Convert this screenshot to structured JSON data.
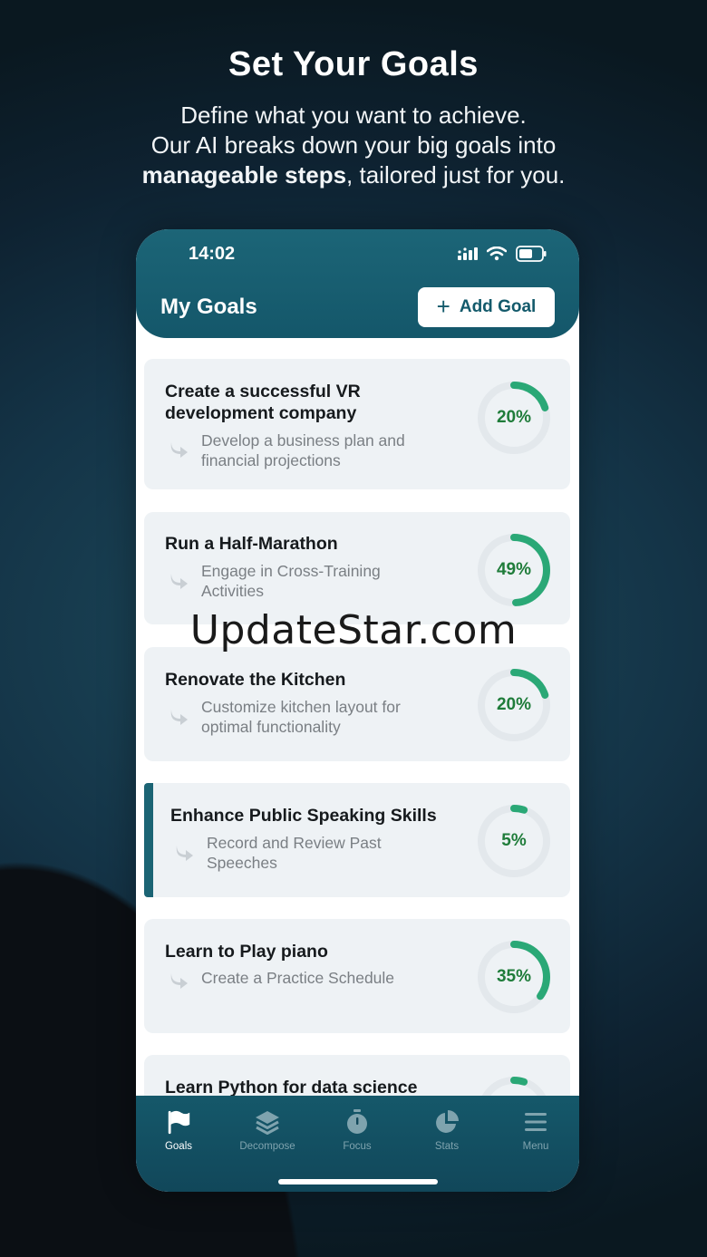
{
  "hero": {
    "title": "Set Your Goals",
    "line1": "Define what you want to achieve.",
    "line2": "Our AI breaks down your big goals  into",
    "line3_bold": "manageable steps",
    "line3_rest": ", tailored just for you."
  },
  "status": {
    "time": "14:02"
  },
  "header": {
    "title": "My Goals",
    "add_label": "Add Goal"
  },
  "goals": [
    {
      "title": "Create a successful VR development company",
      "step": "Develop a business plan and financial projections",
      "percent": 20,
      "percent_label": "20%"
    },
    {
      "title": "Run a Half-Marathon",
      "step": "Engage in Cross-Training Activities",
      "percent": 49,
      "percent_label": "49%"
    },
    {
      "title": "Renovate the Kitchen",
      "step": "Customize kitchen layout for optimal functionality",
      "percent": 20,
      "percent_label": "20%"
    },
    {
      "title": "Enhance Public Speaking Skills",
      "step": "Record and Review Past Speeches",
      "percent": 5,
      "percent_label": "5%"
    },
    {
      "title": "Learn to Play piano",
      "step": "Create a Practice Schedule",
      "percent": 35,
      "percent_label": "35%"
    },
    {
      "title": "Learn Python for data science",
      "percent": 5
    }
  ],
  "selected_goal_index": 3,
  "watermark": "UpdateStar.com",
  "tabs": [
    {
      "label": "Goals",
      "icon": "flag-icon",
      "active": true
    },
    {
      "label": "Decompose",
      "icon": "layers-icon",
      "active": false
    },
    {
      "label": "Focus",
      "icon": "stopwatch-icon",
      "active": false
    },
    {
      "label": "Stats",
      "icon": "pie-chart-icon",
      "active": false
    },
    {
      "label": "Menu",
      "icon": "hamburger-icon",
      "active": false
    }
  ],
  "colors": {
    "header": "#1c6577",
    "progress": "#2aa876",
    "progress_track": "#e3e8ec",
    "percent_text": "#1f7c3a",
    "card_bg": "#eef2f5"
  }
}
